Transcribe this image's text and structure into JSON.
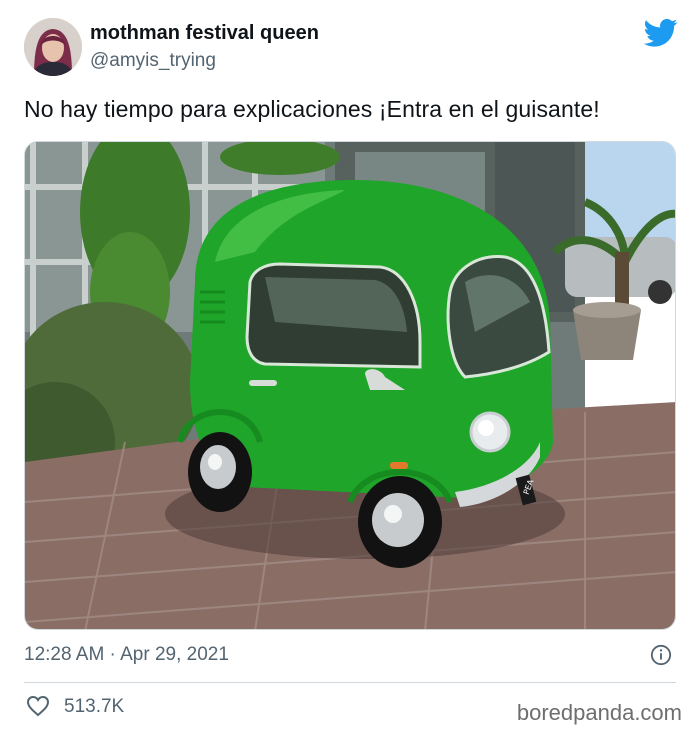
{
  "tweet": {
    "display_name": "mothman festival queen",
    "handle": "@amyis_trying",
    "text": "No hay tiempo para explicaciones ¡Entra en el guisante!",
    "timestamp": "12:28 AM · Apr 29, 2021",
    "likes": "513.7K",
    "plate_text": "PEA"
  },
  "watermark": "boredpanda.com",
  "icons": {
    "brand": "twitter-bird-icon",
    "info": "info-icon",
    "like": "heart-icon"
  },
  "colors": {
    "twitter_blue": "#1d9bf0",
    "text_primary": "#0f1419",
    "text_secondary": "#536471",
    "car_green": "#1fa52a"
  }
}
